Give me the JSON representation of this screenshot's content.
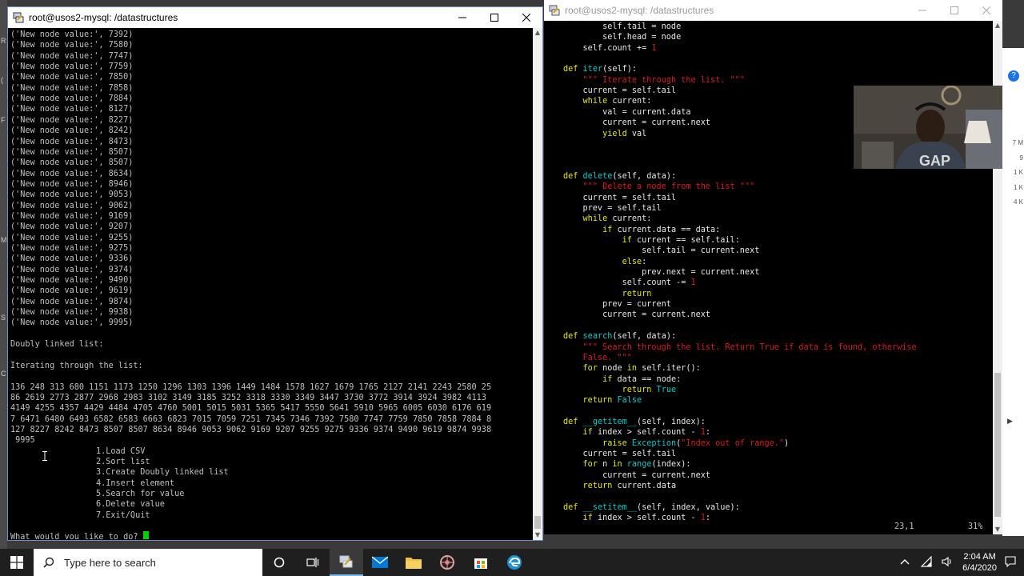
{
  "left_window": {
    "title": "root@usos2-mysql: /datastructures",
    "output_lines": [
      "('New node value:', 7392)",
      "('New node value:', 7580)",
      "('New node value:', 7747)",
      "('New node value:', 7759)",
      "('New node value:', 7850)",
      "('New node value:', 7858)",
      "('New node value:', 7884)",
      "('New node value:', 8127)",
      "('New node value:', 8227)",
      "('New node value:', 8242)",
      "('New node value:', 8473)",
      "('New node value:', 8507)",
      "('New node value:', 8507)",
      "('New node value:', 8634)",
      "('New node value:', 8946)",
      "('New node value:', 9053)",
      "('New node value:', 9062)",
      "('New node value:', 9169)",
      "('New node value:', 9207)",
      "('New node value:', 9255)",
      "('New node value:', 9275)",
      "('New node value:', 9336)",
      "('New node value:', 9374)",
      "('New node value:', 9490)",
      "('New node value:', 9619)",
      "('New node value:', 9874)",
      "('New node value:', 9938)",
      "('New node value:', 9995)",
      "",
      "Doubly linked list:",
      "",
      "Iterating through the list:",
      "",
      "136 248 313 680 1151 1173 1250 1296 1303 1396 1449 1484 1578 1627 1679 1765 2127 2141 2243 2580 25",
      "86 2619 2773 2877 2968 2983 3102 3149 3185 3252 3318 3330 3349 3447 3730 3772 3914 3924 3982 4113",
      "4149 4255 4357 4429 4484 4705 4760 5001 5015 5031 5365 5417 5550 5641 5910 5965 6005 6030 6176 619",
      "7 6471 6480 6493 6582 6583 6663 6823 7015 7059 7251 7345 7346 7392 7580 7747 7759 7850 7858 7884 8",
      "127 8227 8242 8473 8507 8507 8634 8946 9053 9062 9169 9207 9255 9275 9336 9374 9490 9619 9874 9938",
      " 9995"
    ],
    "menu": [
      "1.Load CSV",
      "2.Sort list",
      "3.Create Doubly linked list",
      "4.Insert element",
      "5.Search for value",
      "6.Delete value",
      "7.Exit/Quit"
    ],
    "prompt": "What would you like to do? "
  },
  "right_window": {
    "title": "root@usos2-mysql: /datastructures",
    "status_pos": "23,1",
    "status_pct": "31%"
  },
  "side_letters": [
    "R",
    "(",
    "F",
    "M",
    "S",
    "C"
  ],
  "right_edge_numbers": [
    "7 M",
    "9",
    "1 K",
    "1 K",
    "4 K"
  ],
  "taskbar": {
    "search_placeholder": "Type here to search",
    "time": "2:04 AM",
    "date": "6/4/2020"
  },
  "colors": {
    "keyword": "#e6e600",
    "string": "#d21e1e",
    "builtin": "#00c8c8",
    "cursor": "#00d000"
  }
}
